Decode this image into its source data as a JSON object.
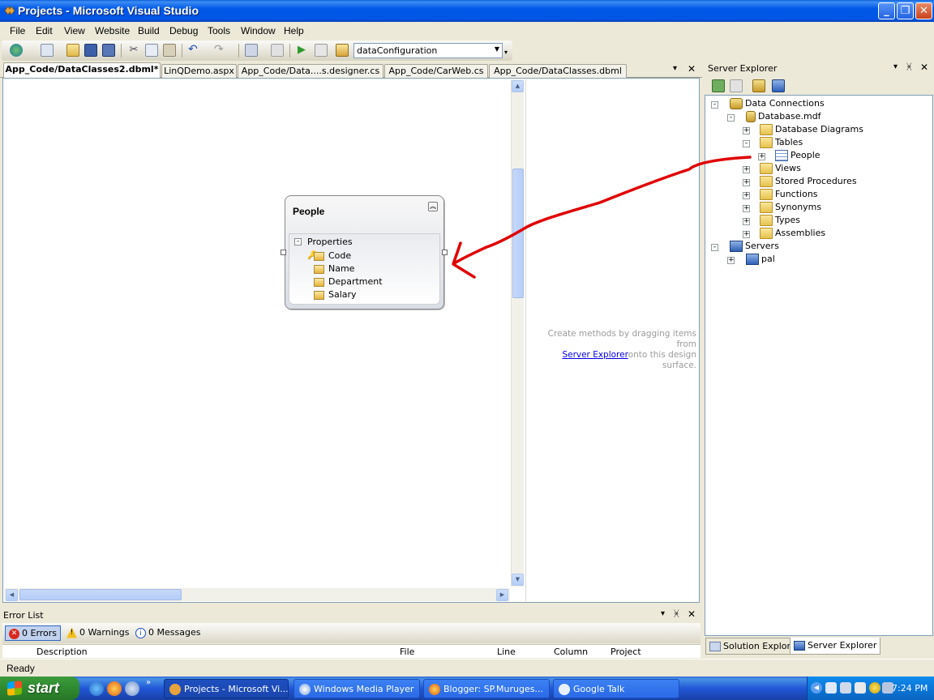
{
  "window": {
    "title": "Projects - Microsoft Visual Studio"
  },
  "menu": [
    "File",
    "Edit",
    "View",
    "Website",
    "Build",
    "Debug",
    "Tools",
    "Window",
    "Help"
  ],
  "toolbar": {
    "configuration": "dataConfiguration"
  },
  "tabs": [
    {
      "label": "App_Code/DataClasses2.dbml*",
      "active": true
    },
    {
      "label": "LinQDemo.aspx"
    },
    {
      "label": "App_Code/Data....s.designer.cs"
    },
    {
      "label": "App_Code/CarWeb.cs"
    },
    {
      "label": "App_Code/DataClasses.dbml"
    }
  ],
  "entity": {
    "name": "People",
    "section": "Properties",
    "properties": [
      "Code",
      "Name",
      "Department",
      "Salary"
    ]
  },
  "methods_hint": {
    "line1": "Create methods by dragging items from",
    "link": "Server Explorer",
    "line2": "onto this design surface."
  },
  "error_list": {
    "title": "Error List",
    "errors": "0 Errors",
    "warnings": "0 Warnings",
    "messages": "0 Messages",
    "columns": [
      "Description",
      "File",
      "Line",
      "Column",
      "Project"
    ]
  },
  "server_explorer": {
    "title": "Server Explorer",
    "tree": {
      "data_connections": "Data Connections",
      "database": "Database.mdf",
      "diagrams": "Database Diagrams",
      "tables": "Tables",
      "people": "People",
      "views": "Views",
      "procedures": "Stored Procedures",
      "functions": "Functions",
      "synonyms": "Synonyms",
      "types": "Types",
      "assemblies": "Assemblies",
      "servers": "Servers",
      "server": "pal"
    },
    "bottom_tabs": {
      "solution": "Solution Explorer",
      "server": "Server Explorer"
    }
  },
  "status": {
    "text": "Ready"
  },
  "taskbar": {
    "start": "start",
    "tasks": [
      "Projects - Microsoft Vi...",
      "Windows Media Player",
      "Blogger: SP.Muruges...",
      "Google Talk"
    ],
    "clock": "7:24 PM"
  },
  "colors": {
    "annotation": "#e00000",
    "titlebar": "#0055e5",
    "taskbar": "#2157d7"
  }
}
